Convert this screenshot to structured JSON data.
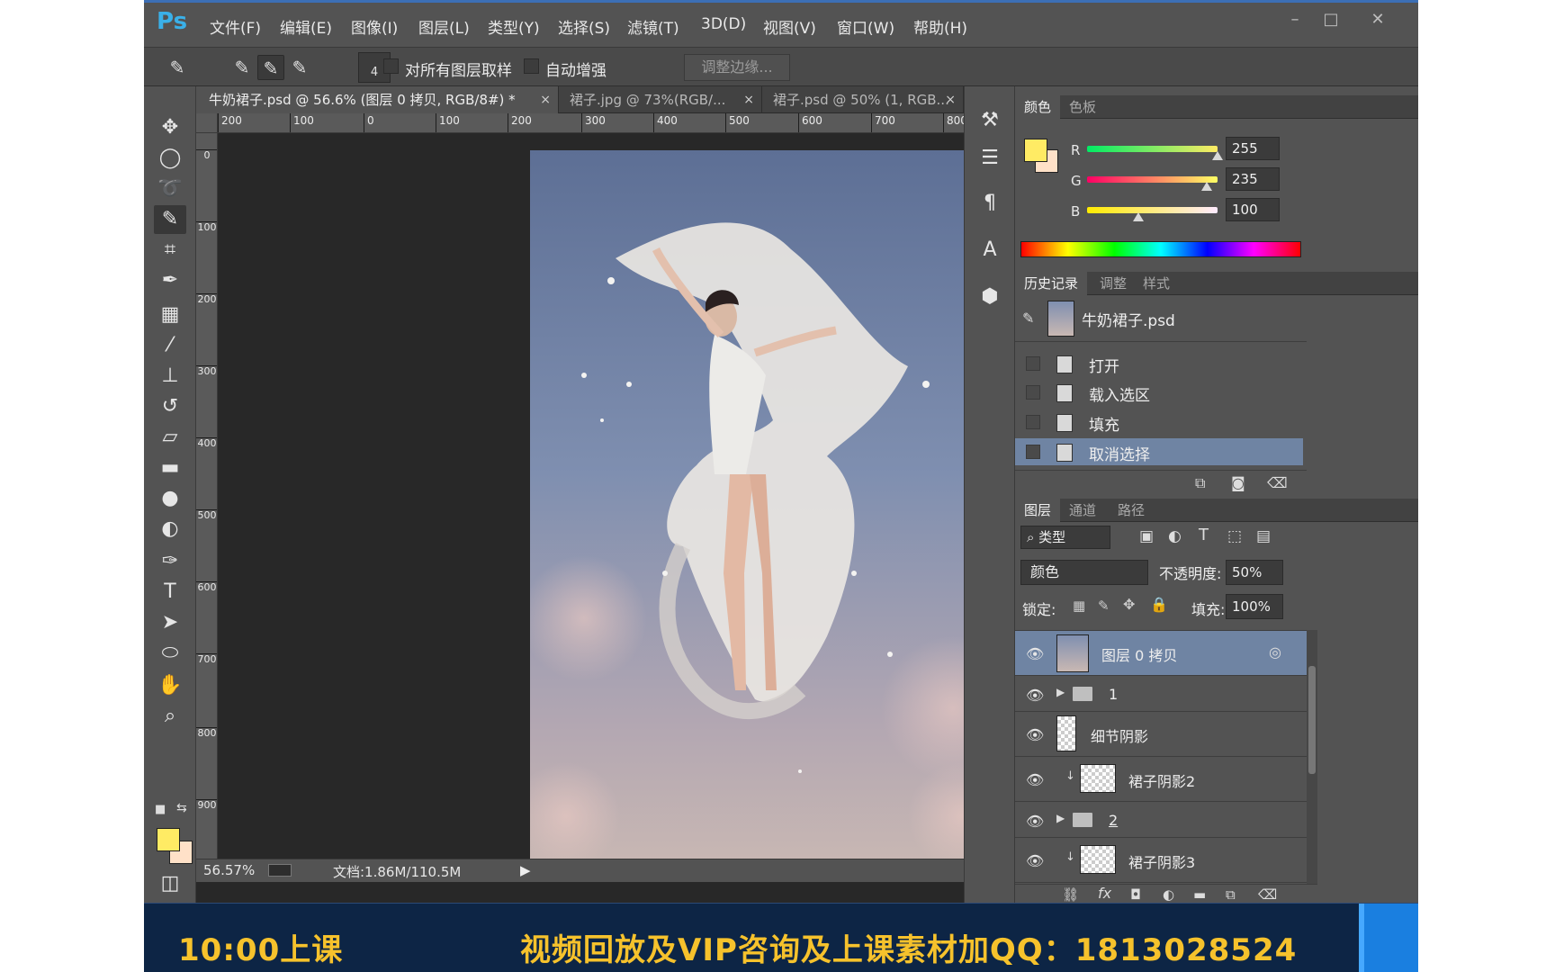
{
  "app": {
    "logo": "Ps",
    "menus": [
      "文件(F)",
      "编辑(E)",
      "图像(I)",
      "图层(L)",
      "类型(Y)",
      "选择(S)",
      "滤镜(T)",
      "3D(D)",
      "视图(V)",
      "窗口(W)",
      "帮助(H)"
    ],
    "window_controls": [
      "–",
      "□",
      "✕"
    ]
  },
  "options": {
    "brush_size": "4",
    "sample_all_layers": "对所有图层取样",
    "auto_enhance": "自动增强",
    "refine_edge": "调整边缘..."
  },
  "tabs": [
    {
      "label": "牛奶裙子.psd @ 56.6% (图层 0 拷贝, RGB/8#) *",
      "close": "×"
    },
    {
      "label": "裙子.jpg @ 73%(RGB/...",
      "close": "×"
    },
    {
      "label": "裙子.psd @ 50% (1, RGB...",
      "close": "×"
    }
  ],
  "rulers": {
    "h": [
      "200",
      "100",
      "0",
      "100",
      "200",
      "300",
      "400",
      "500",
      "600",
      "700",
      "800"
    ],
    "v": [
      "0",
      "100",
      "200",
      "300",
      "400",
      "500",
      "600",
      "700",
      "800",
      "900"
    ]
  },
  "status": {
    "zoom": "56.57%",
    "doc_info": "文档:1.86M/110.5M"
  },
  "color_panel": {
    "tabs": [
      "颜色",
      "色板"
    ],
    "channels": [
      {
        "name": "R",
        "value": "255",
        "fraction": 1.0
      },
      {
        "name": "G",
        "value": "235",
        "fraction": 0.92
      },
      {
        "name": "B",
        "value": "100",
        "fraction": 0.39
      }
    ],
    "fg_color": "#ffeb64",
    "bg_color": "#ffe1c8"
  },
  "history_panel": {
    "tabs": [
      "历史记录",
      "调整",
      "样式"
    ],
    "snapshot": "牛奶裙子.psd",
    "items": [
      "打开",
      "载入选区",
      "填充",
      "取消选择"
    ],
    "selected_index": 3
  },
  "layers_panel": {
    "tabs": [
      "图层",
      "通道",
      "路径"
    ],
    "filter": "类型",
    "blend_mode": "颜色",
    "opacity_label": "不透明度:",
    "opacity": "50%",
    "lock_label": "锁定:",
    "fill_label": "填充:",
    "fill": "100%",
    "layers": [
      {
        "name": "图层 0 拷贝",
        "kind": "image",
        "selected": true
      },
      {
        "name": "1",
        "kind": "folder"
      },
      {
        "name": "细节阴影",
        "kind": "mask"
      },
      {
        "name": "裙子阴影2",
        "kind": "clipped"
      },
      {
        "name": "2",
        "kind": "folder"
      },
      {
        "name": "裙子阴影3",
        "kind": "clipped"
      }
    ]
  },
  "banner": {
    "left": "10:00上课",
    "right": "视频回放及VIP咨询及上课素材加QQ：1813028524"
  }
}
